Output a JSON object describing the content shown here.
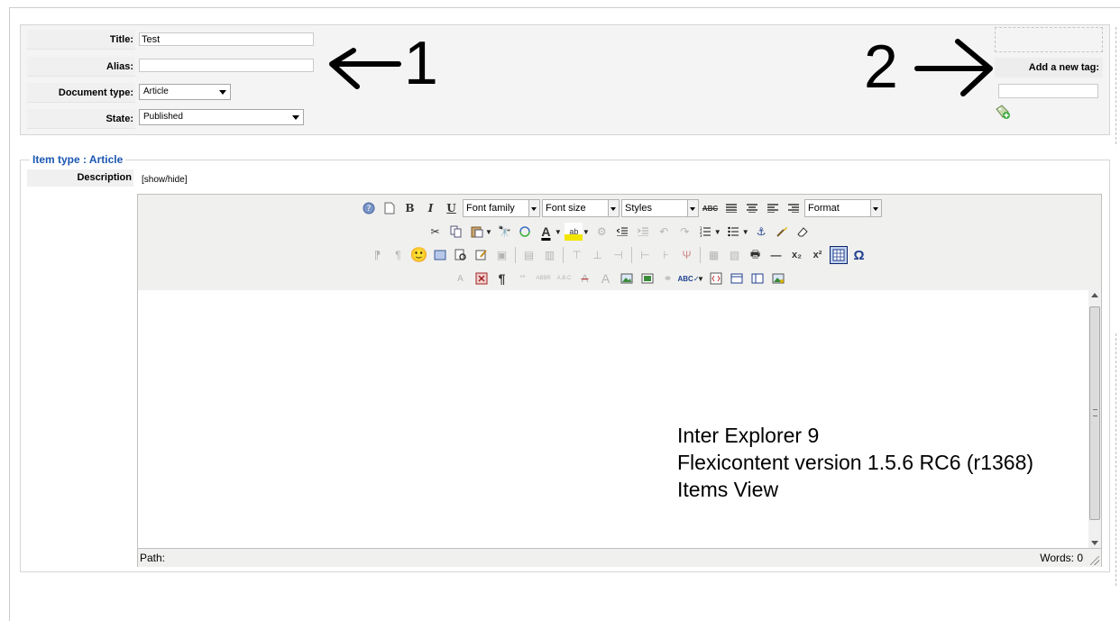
{
  "form": {
    "title_label": "Title:",
    "title_value": "Test",
    "alias_label": "Alias:",
    "alias_value": "",
    "doctype_label": "Document type:",
    "doctype_value": "Article",
    "state_label": "State:",
    "state_value": "Published"
  },
  "annotations": {
    "marker_1": "1",
    "marker_2": "2",
    "note_lines": [
      "Inter Explorer 9",
      "Flexicontent version 1.5.6 RC6 (r1368)",
      "Items View"
    ]
  },
  "tags": {
    "label": "Add a new tag:",
    "input_value": ""
  },
  "item_type": {
    "legend": "Item type : Article",
    "description_label": "Description",
    "toggle_link": "[show/hide]"
  },
  "editor": {
    "font_family": "Font family",
    "font_size": "Font size",
    "styles": "Styles",
    "format": "Format",
    "path_label": "Path:",
    "words_label": "Words: 0"
  },
  "colors": {
    "legend_blue": "#1b57b1",
    "toolbar_bg": "#f0f0ee",
    "panel_bg": "#f4f4f4"
  }
}
